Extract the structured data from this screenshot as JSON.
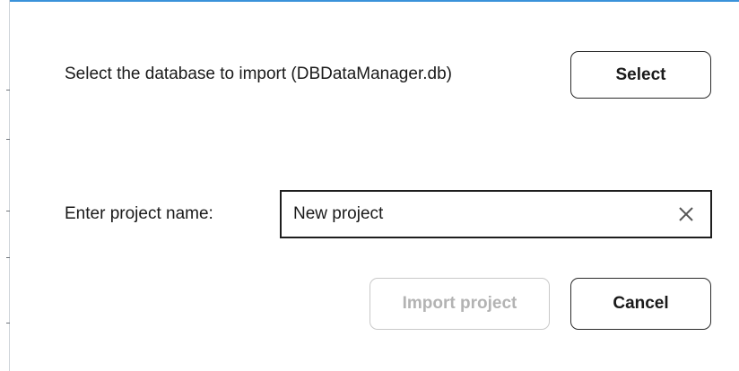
{
  "dialog": {
    "import_label": "Select the database to import (DBDataManager.db)",
    "select_button_label": "Select",
    "project_name_label": "Enter project name:",
    "project_name_value": "New project",
    "clear_icon": "close-x",
    "import_button_label": "Import project",
    "import_button_enabled": false,
    "cancel_button_label": "Cancel"
  },
  "colors": {
    "accent_top_border": "#3a92da",
    "disabled_text": "#b3b3b3",
    "disabled_border": "#c9c9c9"
  }
}
